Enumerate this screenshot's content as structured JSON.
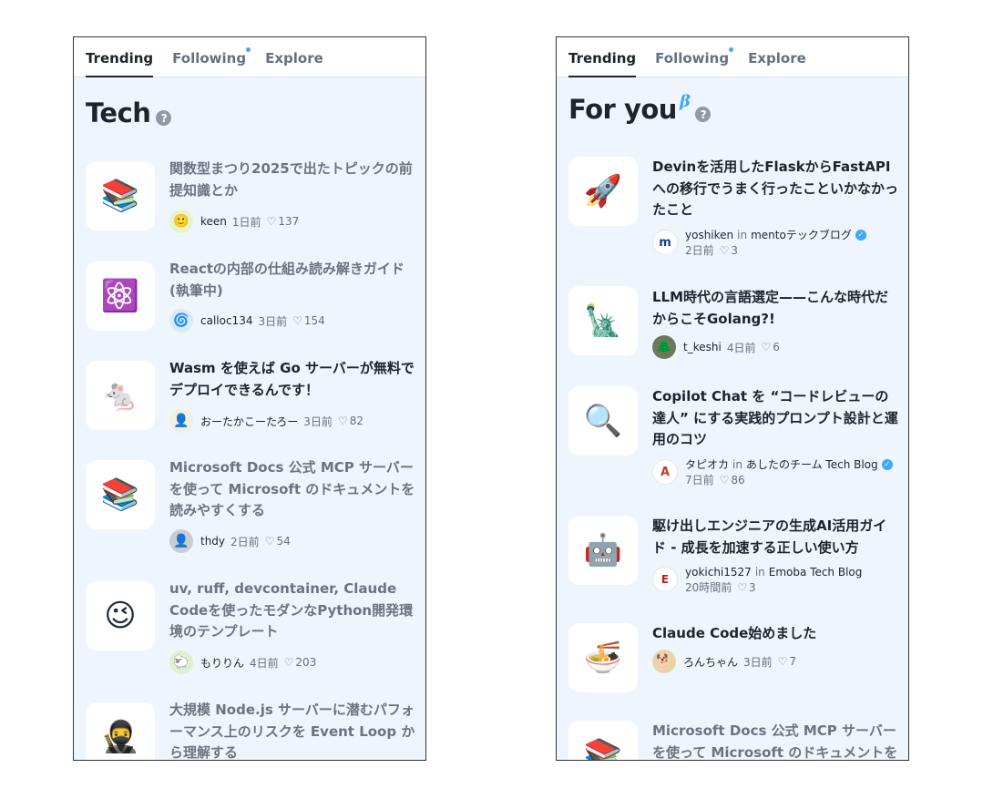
{
  "left": {
    "tabs": [
      "Trending",
      "Following",
      "Explore"
    ],
    "title": "Tech",
    "help": "?",
    "articles": [
      {
        "emoji": "📚",
        "title": "関数型まつり2025で出たトピックの前提知識とか",
        "user": "keen",
        "date": "1日前",
        "likes": "137",
        "avatar": "🙂"
      },
      {
        "emoji": "⚛️",
        "title": "Reactの内部の仕組み読み解きガイド(執筆中)",
        "user": "calloc134",
        "date": "3日前",
        "likes": "154",
        "avatar": "🌀"
      },
      {
        "emoji": "🐁",
        "title": "Wasm を使えば Go サーバーが無料でデプロイできるんです！",
        "user": "おーたかこーたろー",
        "date": "3日前",
        "likes": "82",
        "avatar": "👤"
      },
      {
        "emoji": "📚",
        "title": "Microsoft Docs 公式 MCP サーバーを使って Microsoft のドキュメントを読みやすくする",
        "user": "thdy",
        "date": "2日前",
        "likes": "54",
        "avatar": "👤"
      },
      {
        "emoji": "😉",
        "title": "uv, ruff, devcontainer, Claude Codeを使ったモダンなPython開発環境のテンプレート",
        "user": "もりりん",
        "date": "4日前",
        "likes": "203",
        "avatar": "🐑"
      },
      {
        "emoji": "🥷",
        "title": "大規模 Node.js サーバーに潜むパフォーマンス上のリスクを Event Loop から理解する",
        "user": "",
        "date": "",
        "likes": "",
        "avatar": ""
      }
    ]
  },
  "right": {
    "tabs": [
      "Trending",
      "Following",
      "Explore"
    ],
    "title": "For you",
    "beta": "β",
    "help": "?",
    "articles": [
      {
        "emoji": "🚀",
        "title": "Devinを活用したFlaskからFastAPIへの移行でうまく行ったこといかなかったこと",
        "user": "yoshiken",
        "in": "in",
        "publication": "mentoテックブログ",
        "verified": true,
        "date": "2日前",
        "likes": "3",
        "avatar": "m"
      },
      {
        "emoji": "🗽",
        "title": "LLM時代の言語選定——こんな時代だからこそGolang?!",
        "user": "t_keshi",
        "date": "4日前",
        "likes": "6",
        "avatar": "🌲"
      },
      {
        "emoji": "🔍",
        "title": "Copilot Chat を “コードレビューの達人” にする実践的プロンプト設計と運用のコツ",
        "user": "タピオカ",
        "in": "in",
        "publication": "あしたのチーム Tech Blog",
        "verified": true,
        "date": "7日前",
        "likes": "86",
        "avatar": "A"
      },
      {
        "emoji": "🤖",
        "title": "駆け出しエンジニアの生成AI活用ガイド - 成長を加速する正しい使い方",
        "user": "yokichi1527",
        "in": "in",
        "publication": "Emoba Tech Blog",
        "verified": false,
        "date": "20時間前",
        "likes": "3",
        "avatar": "E"
      },
      {
        "emoji": "🍜",
        "title": "Claude Code始めました",
        "user": "ろんちゃん",
        "date": "3日前",
        "likes": "7",
        "avatar": "🐕"
      },
      {
        "emoji": "📚",
        "title": "Microsoft Docs 公式 MCP サーバーを使って Microsoft のドキュメントを",
        "user": "",
        "date": "",
        "likes": "",
        "avatar": ""
      }
    ]
  },
  "colors": {
    "accent": "#3ea8ff",
    "panel_bg": "#eef5fd",
    "text": "#1e2428",
    "muted": "#65717f"
  }
}
